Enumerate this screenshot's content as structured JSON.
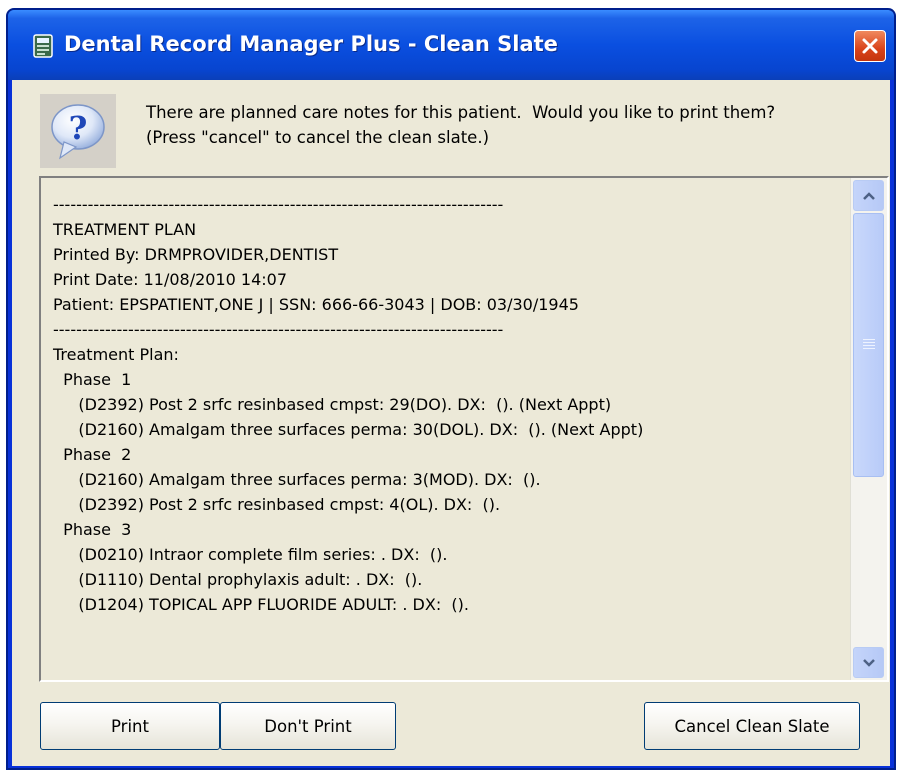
{
  "window": {
    "title": "Dental Record Manager Plus - Clean Slate"
  },
  "message": {
    "line1": "There are planned care notes for this patient.  Would you like to print them?",
    "line2": "(Press \"cancel\" to cancel the clean slate.)"
  },
  "memo_lines": [
    "------------------------------------------------------------------------------",
    "TREATMENT PLAN",
    "Printed By: DRMPROVIDER,DENTIST",
    "Print Date: 11/08/2010 14:07",
    "Patient: EPSPATIENT,ONE J | SSN: 666-66-3043 | DOB: 03/30/1945",
    "------------------------------------------------------------------------------",
    "Treatment Plan:",
    "  Phase  1",
    "     (D2392) Post 2 srfc resinbased cmpst: 29(DO). DX:  (). (Next Appt)",
    "     (D2160) Amalgam three surfaces perma: 30(DOL). DX:  (). (Next Appt)",
    "  Phase  2",
    "     (D2160) Amalgam three surfaces perma: 3(MOD). DX:  ().",
    "     (D2392) Post 2 srfc resinbased cmpst: 4(OL). DX:  ().",
    "  Phase  3",
    "     (D0210) Intraor complete film series: . DX:  ().",
    "     (D1110) Dental prophylaxis adult: . DX:  ().",
    "     (D1204) TOPICAL APP FLUORIDE ADULT: . DX:  ()."
  ],
  "buttons": {
    "print": "Print",
    "dont_print": "Don't Print",
    "cancel": "Cancel Clean Slate"
  },
  "icons": {
    "title": "app-icon",
    "close": "close-icon",
    "message": "question-icon",
    "scroll_up": "chevron-up-icon",
    "scroll_down": "chevron-down-icon"
  },
  "colors": {
    "titlebar": "#0a4fe0",
    "close_button": "#d9431a",
    "dialog_background": "#ece9d8",
    "question_icon": "#1f47b8"
  }
}
